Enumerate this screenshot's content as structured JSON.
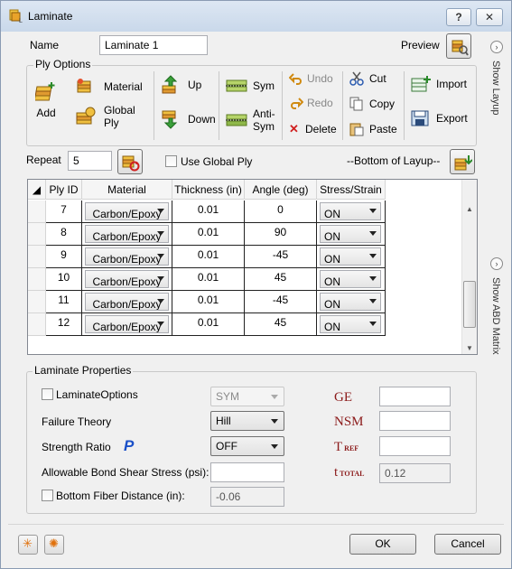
{
  "window": {
    "title": "Laminate",
    "help_label": "?",
    "close_label": "✕"
  },
  "name": {
    "label": "Name",
    "value": "Laminate 1"
  },
  "preview": {
    "label": "Preview"
  },
  "ply_options": {
    "title": "Ply Options",
    "add": "Add",
    "material": "Material",
    "global_ply_1": "Global",
    "global_ply_2": "Ply",
    "up": "Up",
    "down": "Down",
    "sym": "Sym",
    "anti_sym_1": "Anti-",
    "anti_sym_2": "Sym",
    "undo": "Undo",
    "redo": "Redo",
    "delete": "Delete",
    "cut": "Cut",
    "copy": "Copy",
    "paste": "Paste",
    "import": "Import",
    "export": "Export"
  },
  "repeat": {
    "label": "Repeat",
    "value": "5"
  },
  "use_global_ply": "Use Global Ply",
  "bottom_of_layup": "--Bottom of Layup--",
  "side_tabs": {
    "layup": "Show Layup",
    "abd": "Show ABD Matrix"
  },
  "table": {
    "headers": [
      "Ply ID",
      "Material",
      "Thickness (in)",
      "Angle (deg)",
      "Stress/Strain"
    ],
    "rows": [
      {
        "id": "7",
        "material": "Carbon/Epoxy",
        "thickness": "0.01",
        "angle": "0",
        "stress": "ON"
      },
      {
        "id": "8",
        "material": "Carbon/Epoxy",
        "thickness": "0.01",
        "angle": "90",
        "stress": "ON"
      },
      {
        "id": "9",
        "material": "Carbon/Epoxy",
        "thickness": "0.01",
        "angle": "-45",
        "stress": "ON"
      },
      {
        "id": "10",
        "material": "Carbon/Epoxy",
        "thickness": "0.01",
        "angle": "45",
        "stress": "ON"
      },
      {
        "id": "11",
        "material": "Carbon/Epoxy",
        "thickness": "0.01",
        "angle": "-45",
        "stress": "ON"
      },
      {
        "id": "12",
        "material": "Carbon/Epoxy",
        "thickness": "0.01",
        "angle": "45",
        "stress": "ON"
      }
    ]
  },
  "laminate_properties": {
    "title": "Laminate Properties",
    "laminate_options": "LaminateOptions",
    "sym_value": "SYM",
    "failure_theory": "Failure Theory",
    "failure_value": "Hill",
    "strength_ratio": "Strength Ratio",
    "strength_icon": "P",
    "strength_value": "OFF",
    "bond_shear": "Allowable Bond Shear Stress (psi):",
    "bottom_fiber": "Bottom Fiber Distance (in):",
    "bottom_fiber_value": "-0.06",
    "ge": "GE",
    "nsm": "NSM",
    "t_ref_t": "T",
    "t_ref_sub": "REF",
    "t_total_t": "t",
    "t_total_sub": "TOTAL",
    "t_total_value": "0.12"
  },
  "buttons": {
    "ok": "OK",
    "cancel": "Cancel"
  }
}
